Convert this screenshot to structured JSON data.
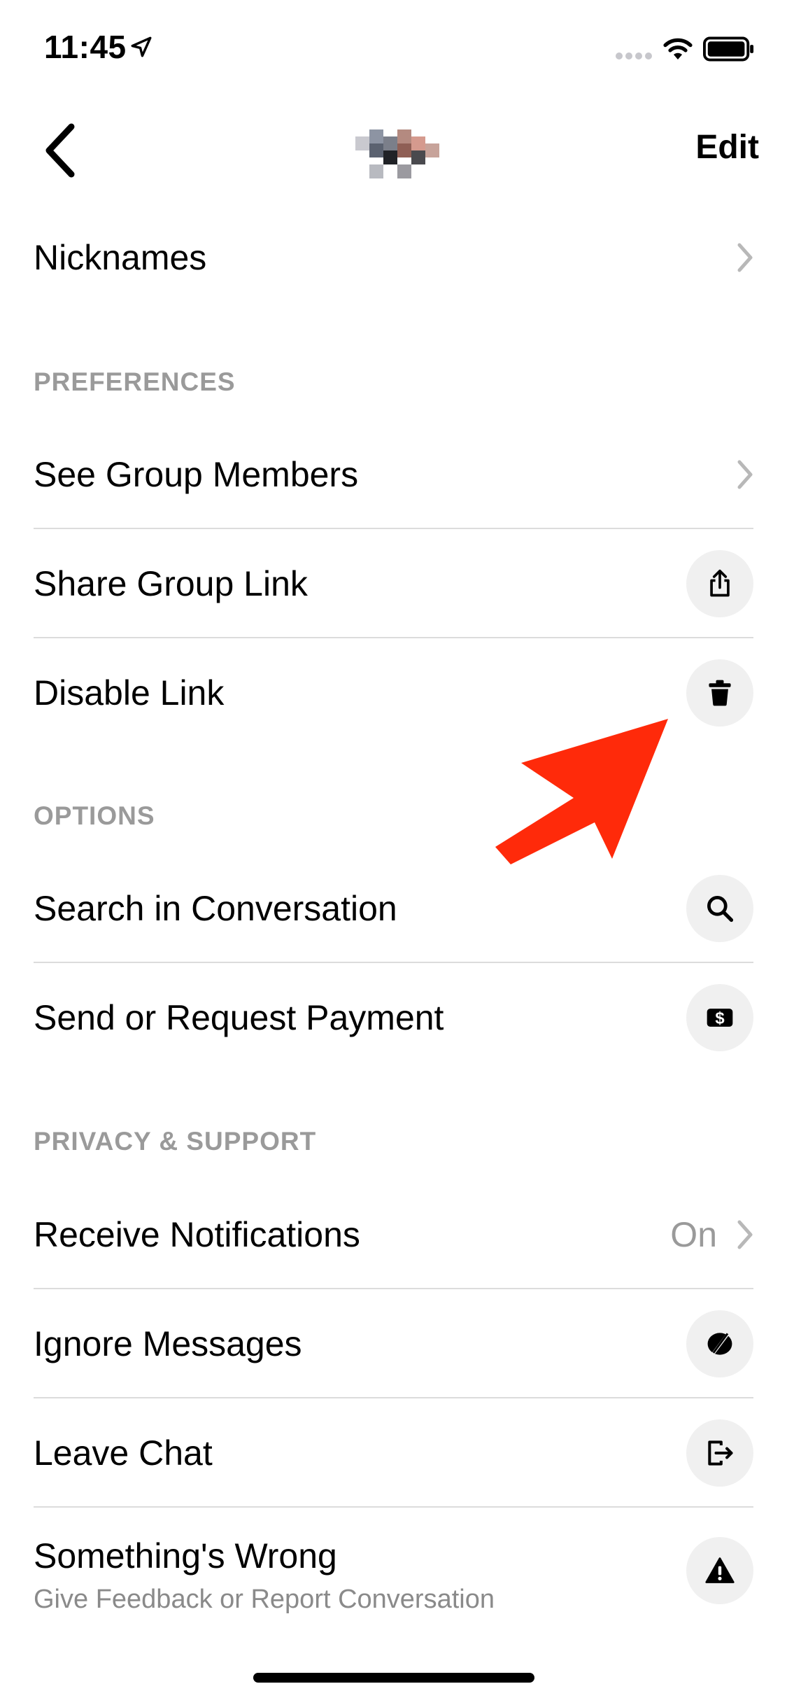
{
  "status_bar": {
    "time": "11:45"
  },
  "nav": {
    "edit_label": "Edit"
  },
  "rows": {
    "nicknames": "Nicknames",
    "see_group_members": "See Group Members",
    "share_group_link": "Share Group Link",
    "disable_link": "Disable Link",
    "search_in_conversation": "Search in Conversation",
    "send_or_request_payment": "Send or Request Payment",
    "receive_notifications": "Receive Notifications",
    "receive_notifications_value": "On",
    "ignore_messages": "Ignore Messages",
    "leave_chat": "Leave Chat",
    "somethings_wrong": "Something's Wrong",
    "somethings_wrong_sub": "Give Feedback or Report Conversation"
  },
  "sections": {
    "preferences": "PREFERENCES",
    "options": "OPTIONS",
    "privacy_support": "PRIVACY & SUPPORT"
  },
  "icons": {
    "share": "share-icon",
    "trash": "trash-icon",
    "search": "search-icon",
    "payment": "dollar-icon",
    "ignore": "ignore-icon",
    "leave": "leave-icon",
    "warning": "warning-icon"
  },
  "colors": {
    "annotation_arrow": "#ff2a0a",
    "section_text": "#9a9a9a"
  }
}
